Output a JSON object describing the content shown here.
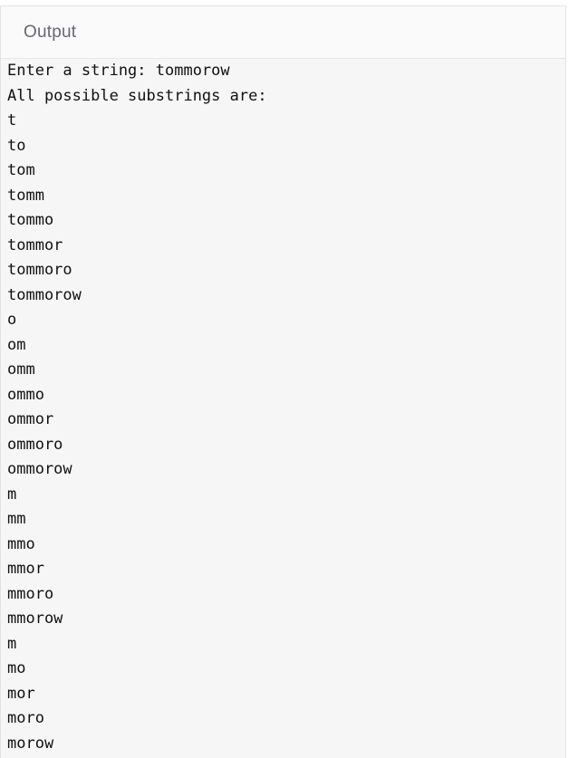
{
  "panel": {
    "title": "Output"
  },
  "console": {
    "lines": [
      "Enter a string: tommorow",
      "All possible substrings are:",
      "t",
      "to",
      "tom",
      "tomm",
      "tommo",
      "tommor",
      "tommoro",
      "tommorow",
      "o",
      "om",
      "omm",
      "ommo",
      "ommor",
      "ommoro",
      "ommorow",
      "m",
      "mm",
      "mmo",
      "mmor",
      "mmoro",
      "mmorow",
      "m",
      "mo",
      "mor",
      "moro",
      "morow"
    ]
  }
}
